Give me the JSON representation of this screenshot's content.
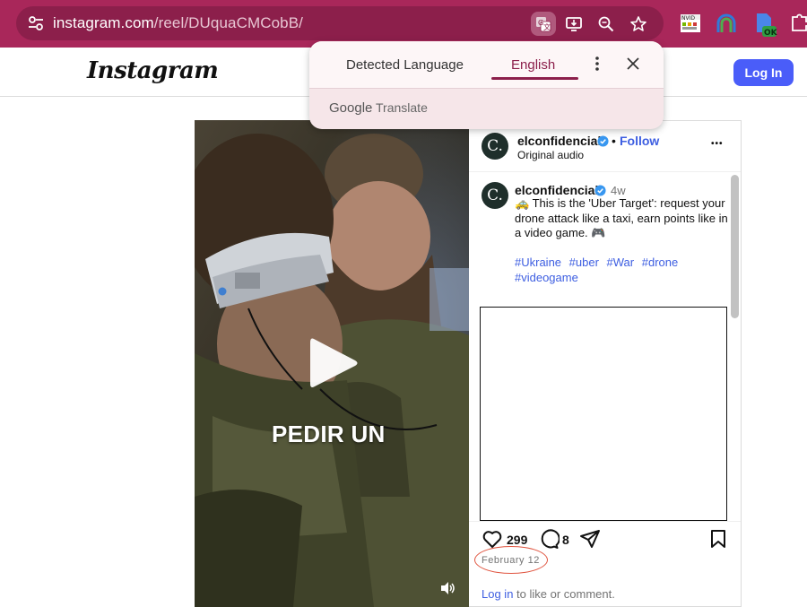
{
  "browser": {
    "url_host": "instagram.com",
    "url_path": "/reel/DUquaCMCobB/",
    "colors": {
      "chrome": "#a9275a",
      "omnibox": "#8c1f4b"
    },
    "extension_labels": {
      "nvidia": "NVID",
      "ok": "OK"
    }
  },
  "translate_popup": {
    "tab_detected": "Detected Language",
    "tab_target": "English",
    "brand_google": "Google",
    "brand_product": "Translate"
  },
  "header": {
    "logo": "Instagram",
    "login_button": "Log In"
  },
  "video": {
    "overlay_text": "PEDIR UN"
  },
  "post": {
    "avatar_letter": "C.",
    "username": "elconfidencial",
    "separator": "•",
    "follow_label": "Follow",
    "audio_label": "Original audio",
    "more_label": "•••",
    "comment_username": "elconfidencial",
    "comment_time": "4w",
    "caption": "🚕 This is the 'Uber Target': request your drone attack like a taxi, earn points like in a video game. 🎮",
    "hashtags": [
      "#Ukraine",
      "#uber",
      "#War",
      "#drone",
      "#videogame"
    ],
    "likes": "299",
    "comments": "8",
    "date": "February 12",
    "login_link": "Log in",
    "login_rest": " to like or comment."
  }
}
